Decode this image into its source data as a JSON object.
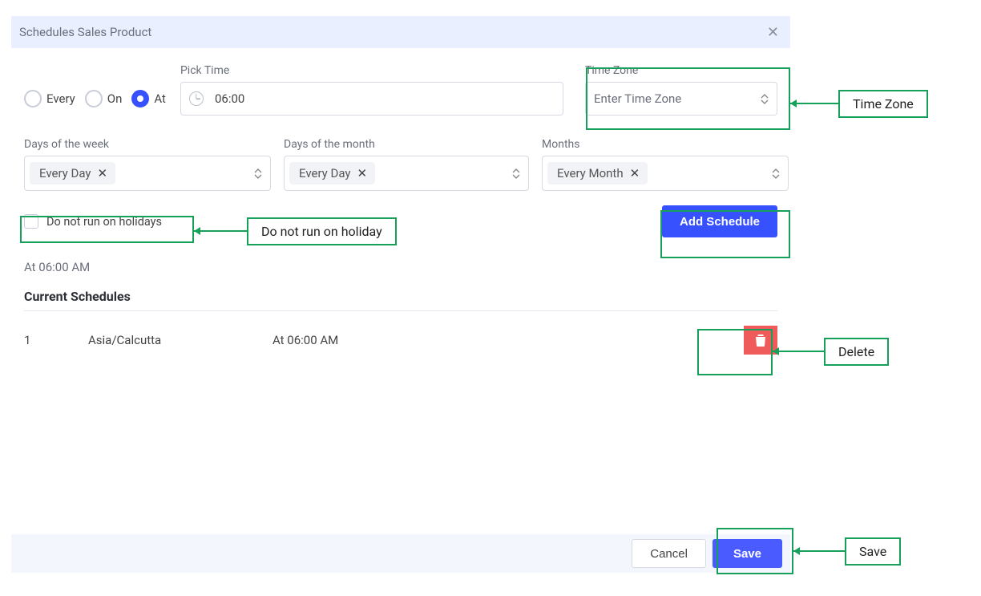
{
  "modal": {
    "title": "Schedules Sales Product",
    "close_x": "✕"
  },
  "radios": {
    "every": "Every",
    "on": "On",
    "at": "At",
    "checked": "at"
  },
  "pick_time": {
    "label": "Pick Time",
    "value": "06:00"
  },
  "time_zone": {
    "label": "Time Zone",
    "placeholder": "Enter Time Zone"
  },
  "days_of_week": {
    "label": "Days of the week",
    "tag": "Every Day",
    "tag_x": "✕"
  },
  "days_of_month": {
    "label": "Days of the month",
    "tag": "Every Day",
    "tag_x": "✕"
  },
  "months": {
    "label": "Months",
    "tag": "Every Month",
    "tag_x": "✕"
  },
  "holiday_checkbox": {
    "label": "Do not run on holidays",
    "checked": false
  },
  "add_schedule_button": "Add Schedule",
  "summary_line": "At 06:00 AM",
  "current_schedules_title": "Current Schedules",
  "schedules": [
    {
      "index": "1",
      "tz": "Asia/Calcutta",
      "time": "At 06:00 AM"
    }
  ],
  "footer": {
    "cancel": "Cancel",
    "save": "Save"
  },
  "annotations": {
    "time_zone": "Time Zone",
    "do_not_run": "Do not run on holiday",
    "delete": "Delete",
    "save": "Save"
  }
}
